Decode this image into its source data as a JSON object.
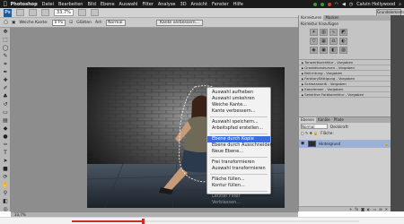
{
  "menubar": {
    "app": "Photoshop",
    "items": [
      "Datei",
      "Bearbeiten",
      "Bild",
      "Ebene",
      "Auswahl",
      "Filter",
      "Analyse",
      "3D",
      "Ansicht",
      "Fenster",
      "Hilfe"
    ],
    "user": "Calvin Hollywood"
  },
  "appbar": {
    "logo": "Ps",
    "zoom": "33,7%",
    "workspace": "Grundelemente"
  },
  "optbar": {
    "weiche_label": "Weiche Kante:",
    "weiche_value": "0 Px",
    "glatten": "Glätten",
    "art_label": "Art:",
    "art_value": "Normal",
    "kante_btn": "Kante verbessern..."
  },
  "context_menu": {
    "items": [
      {
        "label": "Auswahl aufheben",
        "state": "normal"
      },
      {
        "label": "Auswahl umkehren",
        "state": "normal"
      },
      {
        "label": "Weiche Kante...",
        "state": "normal"
      },
      {
        "label": "Kante verbessern...",
        "state": "normal"
      },
      {
        "sep": true
      },
      {
        "label": "Auswahl speichern...",
        "state": "normal"
      },
      {
        "label": "Arbeitspfad erstellen...",
        "state": "normal"
      },
      {
        "sep": true
      },
      {
        "label": "Ebene durch Kopie",
        "state": "active"
      },
      {
        "label": "Ebene durch Ausschneiden",
        "state": "normal"
      },
      {
        "label": "Neue Ebene...",
        "state": "normal"
      },
      {
        "sep": true
      },
      {
        "label": "Frei transformieren",
        "state": "normal"
      },
      {
        "label": "Auswahl transformieren",
        "state": "normal"
      },
      {
        "sep": true
      },
      {
        "label": "Fläche füllen...",
        "state": "normal"
      },
      {
        "label": "Kontur füllen...",
        "state": "normal"
      },
      {
        "sep": true
      },
      {
        "label": "Letzter Filter",
        "state": "disabled"
      },
      {
        "label": "Verblassen...",
        "state": "disabled"
      }
    ]
  },
  "adjust_panel": {
    "tabs": [
      "Korrekturen",
      "Masken"
    ],
    "label": "Korrektur hinzufügen",
    "presets": [
      "Tonwertkorrektur - Vorgaben",
      "Gradationskurven - Vorgaben",
      "Belichtung - Vorgaben",
      "Farbton/Sättigung - Vorgaben",
      "Schwarzweiß - Vorgaben",
      "Kanalmixer - Vorgaben",
      "Selektive Farbkorrektur - Vorgaben"
    ]
  },
  "layers_panel": {
    "tabs": [
      "Ebenen",
      "Kanäle",
      "Pfade"
    ],
    "blend_mode": "Normal",
    "opacity_label": "Deckkraft:",
    "fill_label": "Fläche:",
    "layer_name": "Hintergrund"
  },
  "status": {
    "zoom": "33,7%"
  }
}
